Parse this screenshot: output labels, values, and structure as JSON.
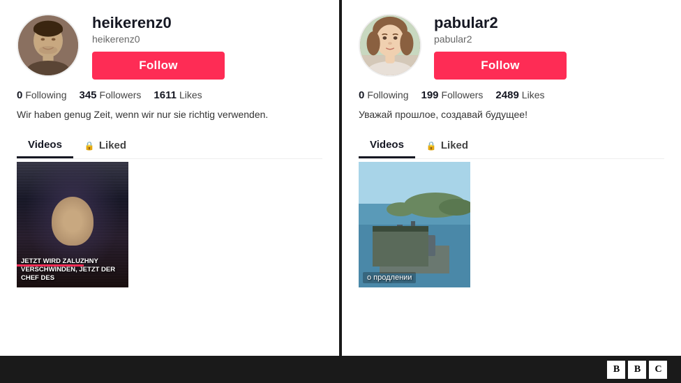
{
  "profiles": [
    {
      "id": "left",
      "username_main": "heikerenz0",
      "username_sub": "heikerenz0",
      "follow_label": "Follow",
      "following_count": "0",
      "following_label": "Following",
      "followers_count": "345",
      "followers_label": "Followers",
      "likes_count": "1611",
      "likes_label": "Likes",
      "bio": "Wir haben genug Zeit, wenn wir nur sie richtig verwenden.",
      "tabs": [
        {
          "label": "Videos",
          "active": true,
          "locked": false
        },
        {
          "label": "Liked",
          "active": false,
          "locked": true
        }
      ],
      "video_caption": "JETZT WIRD ZALUZHNY VERSCHWINDEN, JETZT DER CHEF DES",
      "avatar_type": "male"
    },
    {
      "id": "right",
      "username_main": "pabular2",
      "username_sub": "pabular2",
      "follow_label": "Follow",
      "following_count": "0",
      "following_label": "Following",
      "followers_count": "199",
      "followers_label": "Followers",
      "likes_count": "2489",
      "likes_label": "Likes",
      "bio": "Уважай прошлое, создавай будущее!",
      "tabs": [
        {
          "label": "Videos",
          "active": true,
          "locked": false
        },
        {
          "label": "Liked",
          "active": false,
          "locked": true
        }
      ],
      "video_caption": "о продлении",
      "avatar_type": "female"
    }
  ],
  "bbc": {
    "boxes": [
      "B",
      "B",
      "C"
    ]
  }
}
